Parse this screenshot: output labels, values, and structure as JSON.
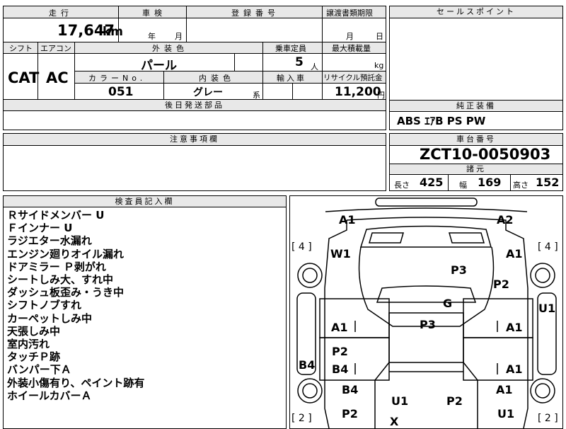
{
  "top_row": {
    "mileage_label": "走行",
    "mileage_value": "17,647",
    "mileage_unit": "km",
    "inspection_label": "車検",
    "inspection_year": "年",
    "inspection_month": "月",
    "registration_label": "登録番号",
    "transfer_label": "譲渡書類期限",
    "transfer_month": "月",
    "transfer_day": "日"
  },
  "sales_point": {
    "label": "セールスポイント"
  },
  "spec_row": {
    "shift_label": "シフト",
    "shift_value": "CAT",
    "aircon_label": "エアコン",
    "aircon_value": "AC",
    "exterior_color_label": "外装色",
    "exterior_color_value": "パール",
    "capacity_label": "乗車定員",
    "capacity_value": "5",
    "capacity_unit": "人",
    "max_load_label": "最大積載量",
    "max_load_unit": "kg",
    "color_no_label": "カラーNo.",
    "color_no_value": "051",
    "interior_color_label": "内装色",
    "interior_color_value": "グレー",
    "interior_color_suffix": "系",
    "import_label": "輸入車",
    "recycle_label": "リサイクル預託金",
    "recycle_value": "11,200",
    "recycle_unit": "円"
  },
  "shipping": {
    "label": "後日発送部品"
  },
  "equipment": {
    "label": "純正装備",
    "value": "ABS ｴｱB PS PW"
  },
  "notes": {
    "label": "注意事項欄"
  },
  "chassis": {
    "label": "車台番号",
    "value": "ZCT10-0050903"
  },
  "dimensions": {
    "label": "諸元",
    "length_label": "長さ",
    "length_value": "425",
    "width_label": "幅",
    "width_value": "169",
    "height_label": "高さ",
    "height_value": "152"
  },
  "inspector": {
    "label": "検査員記入欄",
    "remarks": [
      "Ｒサイドメンバー U",
      "Ｆインナー U",
      "ラジエター水漏れ",
      "エンジン廻りオイル漏れ",
      "ドアミラー Ｐ剥がれ",
      "シートしみ大、すれ中",
      "ダッシュ板歪み・うき中",
      "シフトノブすれ",
      "カーペットしみ中",
      "天張しみ中",
      "室内汚れ",
      "タッチＰ跡",
      "バンパー下Ａ",
      "外装小傷有り、ペイント跡有",
      "ホイールカバーＡ"
    ]
  },
  "diagram": {
    "tire_front_left": "[ 4 ]",
    "tire_front_right": "[ 4 ]",
    "tire_rear_left": "[ 2 ]",
    "tire_rear_right": "[ 2 ]",
    "marks": {
      "front_left_corner": "A1",
      "front_right_corner": "A2",
      "windshield": "W1",
      "front_right_fender": "A1",
      "hood": "P3",
      "right_fender_panel": "P2",
      "right_side_bar": "U1",
      "roof_front": "G",
      "roof": "P3",
      "left_front_door": "A1",
      "right_front_door": "A1",
      "left_side_bar": "B4",
      "left_rear_door_p": "P2",
      "left_rear_door_b": "B4",
      "right_rear_door": "A1",
      "left_quarter": "B4",
      "right_quarter": "A1",
      "rear_left": "U1",
      "rear_right": "P2",
      "rear_left_low": "P2",
      "rear_center": "X",
      "rear_right_low": "U1"
    }
  }
}
